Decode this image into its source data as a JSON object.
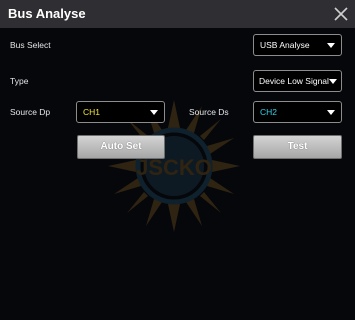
{
  "window": {
    "title": "Bus Analyse",
    "close_icon": "close-icon"
  },
  "bus_select": {
    "label": "Bus Select",
    "value": "USB Analyse"
  },
  "type": {
    "label": "Type",
    "value": "Device Low Signal"
  },
  "source_dp": {
    "label": "Source Dp",
    "value": "CH1",
    "color": "#f3e23a"
  },
  "source_ds": {
    "label": "Source Ds",
    "value": "CH2",
    "color": "#35d0e8"
  },
  "buttons": {
    "auto_set": "Auto Set",
    "test": "Test"
  },
  "watermark": {
    "text": "JSCKO"
  }
}
